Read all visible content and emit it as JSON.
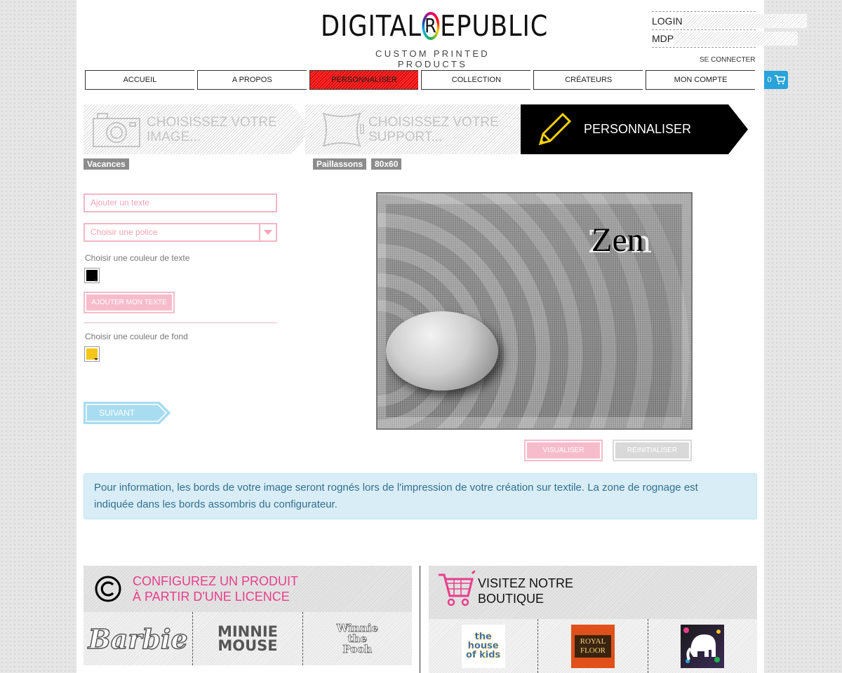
{
  "brand": {
    "left": "DIGITAL",
    "r": "R",
    "right": "EPUBLIC",
    "tagline": "CUSTOM PRINTED PRODUCTS"
  },
  "login": {
    "login_label": "LOGIN",
    "password_label": "MDP",
    "connect_link": "SE CONNECTER"
  },
  "nav": [
    {
      "label": "ACCUEIL"
    },
    {
      "label": "A PROPOS"
    },
    {
      "label": "PERSONNALISER",
      "active": true
    },
    {
      "label": "COLLECTION"
    },
    {
      "label": "CRÉATEURS"
    },
    {
      "label": "MON COMPTE"
    }
  ],
  "cart": {
    "count": "0"
  },
  "steps": [
    {
      "label": "CHOISISSEZ VOTRE IMAGE...",
      "tags": [
        "Vacances"
      ]
    },
    {
      "label": "CHOISISSEZ VOTRE SUPPORT...",
      "tags": [
        "Paillassons",
        "80x60"
      ]
    },
    {
      "label": "PERSONNALISER",
      "active": true
    }
  ],
  "editor": {
    "text_placeholder": "Ajouter un texte",
    "font_placeholder": "Choisir une police",
    "text_color_label": "Choisir une couleur de texte",
    "text_color": "#000000",
    "add_text_button": "AJOUTER MON TEXTE",
    "bg_color_label": "Choisir une couleur de fond",
    "bg_color": "#f5c518",
    "next_button": "SUIVANT"
  },
  "preview": {
    "overlay_text": "Zen",
    "visualize_button": "VISUALISER",
    "reset_button": "REINITIALISER"
  },
  "info": {
    "message": "Pour information, les bords de votre image seront rognés lors de l'impression de votre création sur textile. La zone de rognage est indiquée dans les bords assombris du configurateur."
  },
  "licence_panel": {
    "title_line1": "CONFIGUREZ UN PRODUIT",
    "title_line2": "À PARTIR D'UNE LICENCE",
    "brands": [
      "Barbie",
      "MINNIE MOUSE",
      "Winnie the Pooh"
    ]
  },
  "shop_panel": {
    "title_line1": "VISITEZ NOTRE",
    "title_line2": "BOUTIQUE",
    "products": [
      "the house of kids",
      "ROYAL FLOOR",
      "elephant"
    ]
  },
  "colors": {
    "accent_pink": "#e83e8c",
    "nav_active": "#e31e24",
    "cart_blue": "#29a3d9",
    "info_bg": "#d9edf7"
  }
}
